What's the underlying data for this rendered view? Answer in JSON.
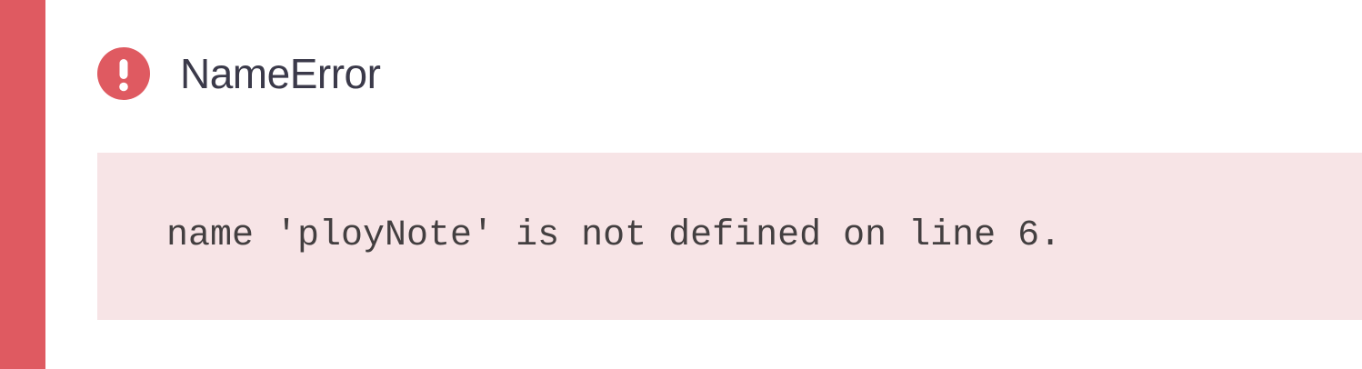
{
  "error": {
    "title": "NameError",
    "message": "name 'ployNote' is not defined on line 6.",
    "icon": "exclamation-circle-icon"
  },
  "colors": {
    "accent": "#df5a61",
    "message_background": "#f7e4e6",
    "title_text": "#3b3a4a",
    "message_text": "#433f40"
  }
}
